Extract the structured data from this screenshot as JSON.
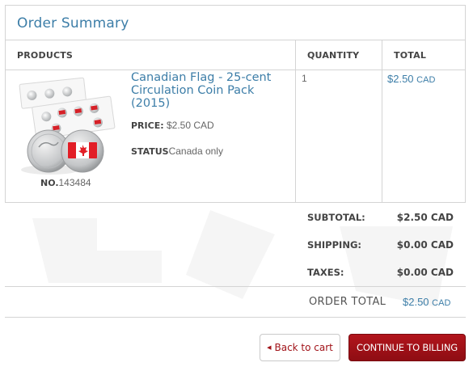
{
  "panel": {
    "title": "Order Summary"
  },
  "table": {
    "headers": {
      "products": "PRODUCTS",
      "quantity": "QUANTITY",
      "total": "TOTAL"
    },
    "item": {
      "name": "Canadian Flag - 25-cent Circulation Coin Pack (2015)",
      "price_label": "PRICE:",
      "price_value": "$2.50 CAD",
      "status_label": "STATUS",
      "status_value": "Canada only",
      "sku_label": "NO.",
      "sku_value": "143484",
      "quantity": "1",
      "total_amount": "$2.50",
      "total_currency": "CAD"
    }
  },
  "summary": {
    "subtotal_label": "SUBTOTAL:",
    "subtotal_value": "$2.50 CAD",
    "shipping_label": "SHIPPING:",
    "shipping_value": "$0.00 CAD",
    "taxes_label": "TAXES:",
    "taxes_value": "$0.00 CAD",
    "order_total_label": "ORDER TOTAL",
    "order_total_amount": "$2.50",
    "order_total_currency": "CAD"
  },
  "actions": {
    "back_label": "Back to cart",
    "continue_label": "CONTINUE TO BILLING"
  },
  "colors": {
    "link": "#3d7ea8",
    "brand_red": "#a11218",
    "border": "#d4d4d4"
  }
}
